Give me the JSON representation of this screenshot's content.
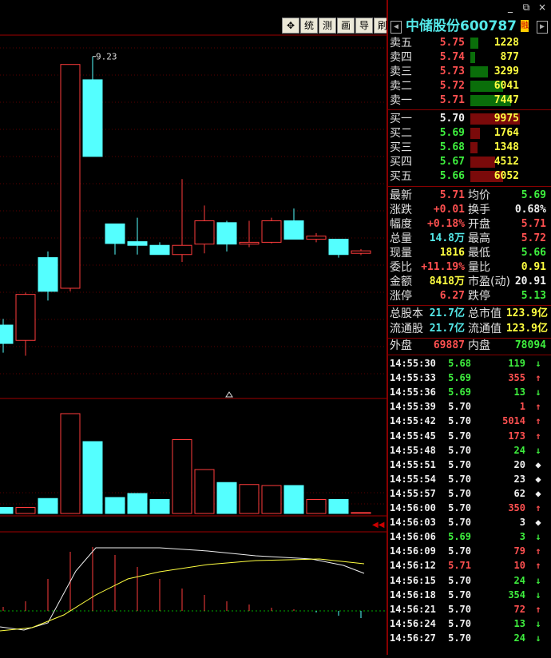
{
  "toolbar": {
    "buttons": [
      "✥",
      "统",
      "测",
      "画",
      "导",
      "刷"
    ]
  },
  "window_controls": [
    "_",
    "⧉",
    "×"
  ],
  "stock": {
    "name": "中储股份600787",
    "tag": "融"
  },
  "order_book": {
    "sell": [
      {
        "label": "卖五",
        "price": "5.75",
        "vol": "1228",
        "frac": 0.16
      },
      {
        "label": "卖四",
        "price": "5.74",
        "vol": "877",
        "frac": 0.09
      },
      {
        "label": "卖三",
        "price": "5.73",
        "vol": "3299",
        "frac": 0.35
      },
      {
        "label": "卖二",
        "price": "5.72",
        "vol": "6041",
        "frac": 0.66
      },
      {
        "label": "卖一",
        "price": "5.71",
        "vol": "7447",
        "frac": 0.82
      }
    ],
    "buy": [
      {
        "label": "买一",
        "price": "5.70",
        "vol": "9975",
        "frac": 1.0
      },
      {
        "label": "买二",
        "price": "5.69",
        "vol": "1764",
        "frac": 0.2
      },
      {
        "label": "买三",
        "price": "5.68",
        "vol": "1348",
        "frac": 0.14
      },
      {
        "label": "买四",
        "price": "5.67",
        "vol": "4512",
        "frac": 0.5
      },
      {
        "label": "买五",
        "price": "5.66",
        "vol": "6052",
        "frac": 0.66
      }
    ]
  },
  "quote": [
    {
      "l1": "最新",
      "v1": "5.71",
      "c1": "red",
      "l2": "均价",
      "v2": "5.69",
      "c2": "green"
    },
    {
      "l1": "涨跌",
      "v1": "+0.01",
      "c1": "red",
      "l2": "换手",
      "v2": "0.68%",
      "c2": "white"
    },
    {
      "l1": "幅度",
      "v1": "+0.18%",
      "c1": "red",
      "l2": "开盘",
      "v2": "5.71",
      "c2": "red"
    },
    {
      "l1": "总量",
      "v1": "14.8万",
      "c1": "cyan",
      "l2": "最高",
      "v2": "5.72",
      "c2": "red"
    },
    {
      "l1": "现量",
      "v1": "1816",
      "c1": "yellow",
      "l2": "最低",
      "v2": "5.66",
      "c2": "green"
    },
    {
      "l1": "委比",
      "v1": "+11.19%",
      "c1": "red",
      "l2": "量比",
      "v2": "0.91",
      "c2": "yellow"
    },
    {
      "l1": "金额",
      "v1": "8418万",
      "c1": "yellow",
      "l2": "市盈(动)",
      "v2": "20.91",
      "c2": "white"
    },
    {
      "l1": "涨停",
      "v1": "6.27",
      "c1": "red",
      "l2": "跌停",
      "v2": "5.13",
      "c2": "green"
    }
  ],
  "capital": [
    {
      "l1": "总股本",
      "v1": "21.7亿",
      "l2": "总市值",
      "v2": "123.9亿"
    },
    {
      "l1": "流通股",
      "v1": "21.7亿",
      "l2": "流通值",
      "v2": "123.9亿"
    }
  ],
  "inout": {
    "out_label": "外盘",
    "out_val": "69887",
    "in_label": "内盘",
    "in_val": "78094"
  },
  "ticks": [
    {
      "t": "14:55:30",
      "p": "5.68",
      "pc": "green",
      "v": "119",
      "vc": "green",
      "a": "↓",
      "ac": "green"
    },
    {
      "t": "14:55:33",
      "p": "5.69",
      "pc": "green",
      "v": "355",
      "vc": "red",
      "a": "↑",
      "ac": "red"
    },
    {
      "t": "14:55:36",
      "p": "5.69",
      "pc": "green",
      "v": "13",
      "vc": "green",
      "a": "↓",
      "ac": "green"
    },
    {
      "t": "14:55:39",
      "p": "5.70",
      "pc": "white",
      "v": "1",
      "vc": "red",
      "a": "↑",
      "ac": "red"
    },
    {
      "t": "14:55:42",
      "p": "5.70",
      "pc": "white",
      "v": "5014",
      "vc": "red",
      "a": "↑",
      "ac": "red"
    },
    {
      "t": "14:55:45",
      "p": "5.70",
      "pc": "white",
      "v": "173",
      "vc": "red",
      "a": "↑",
      "ac": "red"
    },
    {
      "t": "14:55:48",
      "p": "5.70",
      "pc": "white",
      "v": "24",
      "vc": "green",
      "a": "↓",
      "ac": "green"
    },
    {
      "t": "14:55:51",
      "p": "5.70",
      "pc": "white",
      "v": "20",
      "vc": "white",
      "a": "◆",
      "ac": "white"
    },
    {
      "t": "14:55:54",
      "p": "5.70",
      "pc": "white",
      "v": "23",
      "vc": "white",
      "a": "◆",
      "ac": "white"
    },
    {
      "t": "14:55:57",
      "p": "5.70",
      "pc": "white",
      "v": "62",
      "vc": "white",
      "a": "◆",
      "ac": "white"
    },
    {
      "t": "14:56:00",
      "p": "5.70",
      "pc": "white",
      "v": "350",
      "vc": "red",
      "a": "↑",
      "ac": "red"
    },
    {
      "t": "14:56:03",
      "p": "5.70",
      "pc": "white",
      "v": "3",
      "vc": "white",
      "a": "◆",
      "ac": "white"
    },
    {
      "t": "14:56:06",
      "p": "5.69",
      "pc": "green",
      "v": "3",
      "vc": "green",
      "a": "↓",
      "ac": "green"
    },
    {
      "t": "14:56:09",
      "p": "5.70",
      "pc": "white",
      "v": "79",
      "vc": "red",
      "a": "↑",
      "ac": "red"
    },
    {
      "t": "14:56:12",
      "p": "5.71",
      "pc": "red",
      "v": "10",
      "vc": "red",
      "a": "↑",
      "ac": "red"
    },
    {
      "t": "14:56:15",
      "p": "5.70",
      "pc": "white",
      "v": "24",
      "vc": "green",
      "a": "↓",
      "ac": "green"
    },
    {
      "t": "14:56:18",
      "p": "5.70",
      "pc": "white",
      "v": "354",
      "vc": "green",
      "a": "↓",
      "ac": "green"
    },
    {
      "t": "14:56:21",
      "p": "5.70",
      "pc": "white",
      "v": "72",
      "vc": "red",
      "a": "↑",
      "ac": "red"
    },
    {
      "t": "14:56:24",
      "p": "5.70",
      "pc": "white",
      "v": "13",
      "vc": "green",
      "a": "↓",
      "ac": "green"
    },
    {
      "t": "14:56:27",
      "p": "5.70",
      "pc": "white",
      "v": "24",
      "vc": "green",
      "a": "↓",
      "ac": "green"
    }
  ],
  "chart_data": {
    "type": "candlestick",
    "annotations": [
      "9.23"
    ],
    "candles": [
      {
        "o": 4.55,
        "c": 4.85,
        "h": 4.95,
        "l": 4.4,
        "up": false
      },
      {
        "o": 4.6,
        "c": 5.35,
        "h": 5.38,
        "l": 4.35,
        "up": true
      },
      {
        "o": 5.4,
        "c": 5.95,
        "h": 6.05,
        "l": 5.25,
        "up": false
      },
      {
        "o": 5.45,
        "c": 9.1,
        "h": 9.1,
        "l": 5.4,
        "up": true
      },
      {
        "o": 8.85,
        "c": 7.6,
        "h": 9.23,
        "l": 7.6,
        "up": false
      },
      {
        "o": 6.5,
        "c": 6.18,
        "h": 6.5,
        "l": 6.0,
        "up": false
      },
      {
        "o": 6.21,
        "c": 6.15,
        "h": 6.6,
        "l": 6.0,
        "up": false
      },
      {
        "o": 6.15,
        "c": 6.0,
        "h": 6.2,
        "l": 6.0,
        "up": false
      },
      {
        "o": 6.0,
        "c": 6.15,
        "h": 7.23,
        "l": 5.88,
        "up": true
      },
      {
        "o": 6.17,
        "c": 6.55,
        "h": 6.8,
        "l": 6.02,
        "up": true
      },
      {
        "o": 6.52,
        "c": 6.17,
        "h": 6.55,
        "l": 6.05,
        "up": false
      },
      {
        "o": 6.17,
        "c": 6.2,
        "h": 6.55,
        "l": 6.12,
        "up": true
      },
      {
        "o": 6.2,
        "c": 6.55,
        "h": 6.6,
        "l": 6.18,
        "up": true
      },
      {
        "o": 6.55,
        "c": 6.25,
        "h": 6.75,
        "l": 6.25,
        "up": false
      },
      {
        "o": 6.25,
        "c": 6.3,
        "h": 6.35,
        "l": 6.2,
        "up": true
      },
      {
        "o": 6.25,
        "c": 6.0,
        "h": 6.25,
        "l": 5.95,
        "up": false
      },
      {
        "o": 6.02,
        "c": 6.06,
        "h": 6.09,
        "l": 5.99,
        "up": true
      }
    ],
    "volumes": [
      0.06,
      0.06,
      0.15,
      1.0,
      0.72,
      0.16,
      0.2,
      0.14,
      0.74,
      0.44,
      0.31,
      0.29,
      0.28,
      0.28,
      0.14,
      0.14,
      0.01
    ]
  }
}
